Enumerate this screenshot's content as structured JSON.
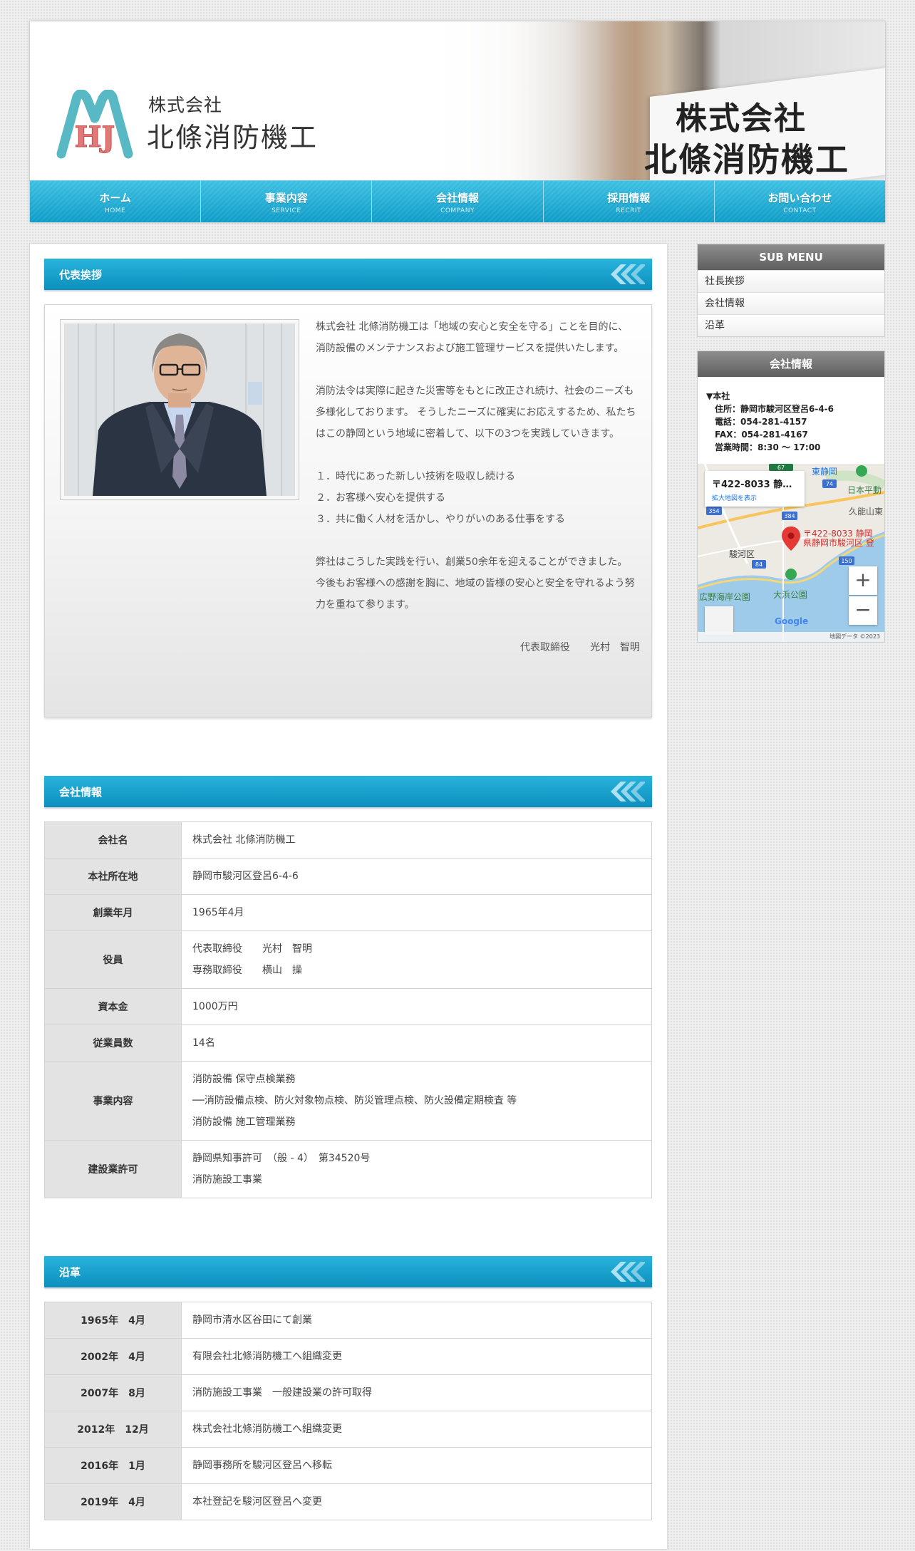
{
  "brand": {
    "kabushiki": "株式会社",
    "name": "北條消防機工",
    "logo_letters": "HJ",
    "photo_sign_line1": "株式会社",
    "photo_sign_line2": "北條消防機工"
  },
  "nav": [
    {
      "label": "ホーム",
      "sub": "HOME"
    },
    {
      "label": "事業内容",
      "sub": "SERVICE"
    },
    {
      "label": "会社情報",
      "sub": "COMPANY"
    },
    {
      "label": "採用情報",
      "sub": "RECRIT"
    },
    {
      "label": "お問い合わせ",
      "sub": "CONTACT"
    }
  ],
  "greeting": {
    "title": "代表挨拶",
    "p1": "株式会社 北條消防機工は「地域の安心と安全を守る」ことを目的に、 消防設備のメンテナンスおよび施工管理サービスを提供いたします。",
    "p2": "消防法令は実際に起きた災害等をもとに改正され続け、社会のニーズも多様化しております。 そうしたニーズに確実にお応えするため、私たちはこの静岡という地域に密着して、以下の3つを実践していきます。",
    "list": [
      "１．時代にあった新しい技術を吸収し続ける",
      "２．お客様へ安心を提供する",
      "３．共に働く人材を活かし、やりがいのある仕事をする"
    ],
    "p3": "弊社はこうした実践を行い、創業50余年を迎えることができました。 今後もお客様への感謝を胸に、地域の皆様の安心と安全を守れるよう努力を重ねて参ります。",
    "signature": "代表取締役　　光村　智明"
  },
  "company": {
    "title": "会社情報",
    "rows": [
      {
        "label": "会社名",
        "lines": [
          "株式会社 北條消防機工"
        ]
      },
      {
        "label": "本社所在地",
        "lines": [
          "静岡市駿河区登呂6-4-6"
        ]
      },
      {
        "label": "創業年月",
        "lines": [
          "1965年4月"
        ]
      },
      {
        "label": "役員",
        "lines": [
          "代表取締役　　光村　智明",
          "専務取締役　　横山　操"
        ]
      },
      {
        "label": "資本金",
        "lines": [
          "1000万円"
        ]
      },
      {
        "label": "従業員数",
        "lines": [
          "14名"
        ]
      },
      {
        "label": "事業内容",
        "lines": [
          "消防設備 保守点検業務",
          "──消防設備点検、防火対象物点検、防災管理点検、防火設備定期検査 等",
          "消防設備 施工管理業務"
        ]
      },
      {
        "label": "建設業許可",
        "lines": [
          "静岡県知事許可　（般 - 4）　第34520号",
          "消防施設工事業"
        ]
      }
    ]
  },
  "history": {
    "title": "沿革",
    "rows": [
      {
        "date": "1965年　4月",
        "event": "静岡市清水区谷田にて創業"
      },
      {
        "date": "2002年　4月",
        "event": "有限会社北條消防機工へ組織変更"
      },
      {
        "date": "2007年　8月",
        "event": "消防施設工事業　一般建設業の許可取得"
      },
      {
        "date": "2012年　12月",
        "event": "株式会社北條消防機工へ組織変更"
      },
      {
        "date": "2016年　1月",
        "event": "静岡事務所を駿河区登呂へ移転"
      },
      {
        "date": "2019年　4月",
        "event": "本社登記を駿河区登呂へ変更"
      }
    ]
  },
  "sidebar": {
    "submenu_title": "SUB MENU",
    "submenu": [
      "社長挨拶",
      "会社情報",
      "沿革"
    ],
    "info_title": "会社情報",
    "info": {
      "office": "▼本社",
      "address": "住所：静岡市駿河区登呂6-4-6",
      "tel": "電話：054-281-4157",
      "fax": "FAX：054-281-4167",
      "hours": "営業時間：8:30 〜 17:00"
    },
    "map": {
      "card_title": "〒422-8033 静…",
      "card_link": "拡大地図を表示",
      "pin_label_1": "〒422-8033 静岡",
      "pin_label_2": "県静岡市駿河区 登",
      "places": [
        "東静岡",
        "日本平動",
        "久能山東",
        "駿河区",
        "広野海岸公園",
        "大浜公園"
      ],
      "route_numbers": [
        "67",
        "74",
        "354",
        "384",
        "84",
        "150"
      ],
      "zoom_in": "+",
      "zoom_out": "−",
      "google": "Google",
      "footer": "地図データ ©2023"
    }
  },
  "colors": {
    "accent": "#1aa5d0",
    "nav_dark": "#0f9cc7",
    "side_head": "#6f6f6f",
    "pin": "#e53935"
  }
}
